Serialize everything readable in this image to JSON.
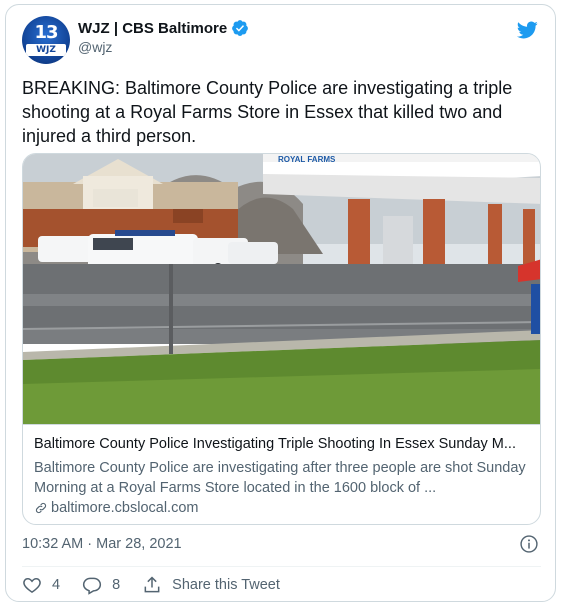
{
  "account": {
    "display_name": "WJZ | CBS Baltimore",
    "handle": "@wjz",
    "avatar_logo_number": "13",
    "avatar_logo_text": "WJZ"
  },
  "tweet": {
    "text": "BREAKING: Baltimore County Police are investigating a triple shooting at a Royal Farms Store in Essex that killed two and injured a third person."
  },
  "link_card": {
    "image_alt": "Royal Farms store with police vehicles in the parking lot",
    "store_sign": "ROYAL FARMS",
    "title": "Baltimore County Police Investigating Triple Shooting In Essex Sunday M...",
    "description": "Baltimore County Police are investigating after three people are shot Sunday Morning at a Royal Farms Store located in the 1600 block of ...",
    "domain": "baltimore.cbslocal.com"
  },
  "meta": {
    "timestamp": "10:32 AM · Mar 28, 2021"
  },
  "actions": {
    "like_count": "4",
    "reply_count": "8",
    "share_label": "Share this Tweet"
  },
  "colors": {
    "twitter_blue": "#1d9bf0",
    "text_primary": "#0f1419",
    "text_secondary": "#536471",
    "border": "#cfd9de"
  }
}
